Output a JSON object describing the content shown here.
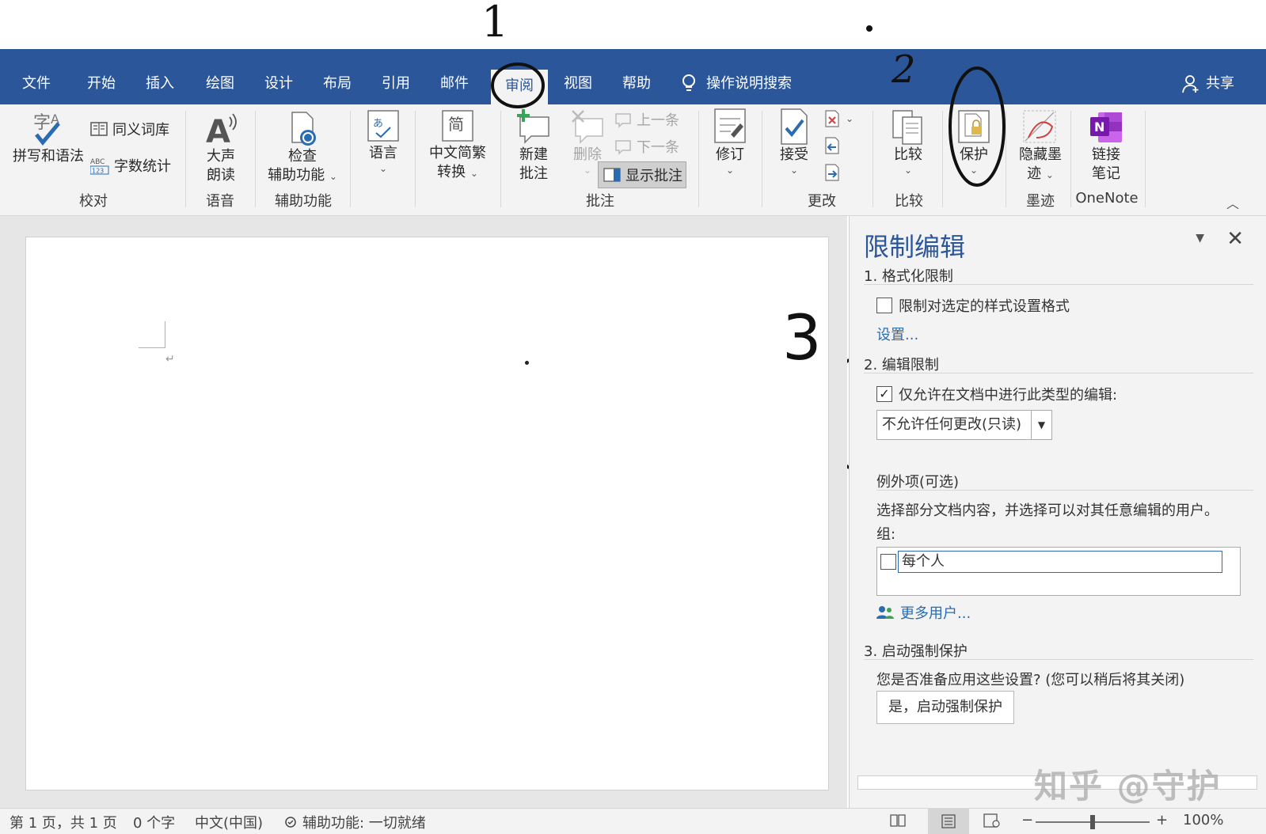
{
  "annotations": {
    "step1": "1",
    "step2": "2",
    "step3": "3"
  },
  "tabs": [
    "文件",
    "开始",
    "插入",
    "绘图",
    "设计",
    "布局",
    "引用",
    "邮件",
    "审阅",
    "视图",
    "帮助"
  ],
  "active_tab": "审阅",
  "tell_me": "操作说明搜索",
  "share_label": "共享",
  "ribbon": {
    "proofing": {
      "spelling": "拼写和语法",
      "thesaurus": "同义词库",
      "word_count": "字数统计",
      "group": "校对"
    },
    "speech": {
      "read_aloud_1": "大声",
      "read_aloud_2": "朗读",
      "group": "语音"
    },
    "accessibility": {
      "check_1": "检查",
      "check_2": "辅助功能",
      "group": "辅助功能"
    },
    "language": {
      "label": "语言"
    },
    "chinese_conv": {
      "label_1": "中文简繁",
      "label_2": "转换"
    },
    "comments": {
      "new_1": "新建",
      "new_2": "批注",
      "delete": "删除",
      "prev": "上一条",
      "next": "下一条",
      "show": "显示批注",
      "group": "批注"
    },
    "tracking": {
      "label": "修订"
    },
    "changes": {
      "accept": "接受",
      "group": "更改"
    },
    "compare": {
      "label": "比较",
      "group": "比较"
    },
    "protect": {
      "label": "保护"
    },
    "ink": {
      "hide_1": "隐藏墨",
      "hide_2": "迹",
      "group": "墨迹"
    },
    "onenote": {
      "link_1": "链接",
      "link_2": "笔记",
      "group": "OneNote"
    }
  },
  "pane": {
    "title": "限制编辑",
    "section1": "1. 格式化限制",
    "format_limit": "限制对选定的样式设置格式",
    "settings_link": "设置...",
    "section2": "2. 编辑限制",
    "edit_limit": "仅允许在文档中进行此类型的编辑:",
    "edit_limit_checked": true,
    "edit_type": "不允许任何更改(只读)",
    "exceptions_h": "例外项(可选)",
    "exceptions_desc": "选择部分文档内容，并选择可以对其任意编辑的用户。",
    "groups_label": "组:",
    "group_item": "每个人",
    "more_users": "更多用户...",
    "section3": "3. 启动强制保护",
    "enforce_desc": "您是否准备应用这些设置? (您可以稍后将其关闭)",
    "enforce_btn": "是，启动强制保护"
  },
  "status": {
    "page": "第 1 页，共 1 页",
    "words": "0 个字",
    "lang": "中文(中国)",
    "a11y": "辅助功能: 一切就绪",
    "zoom": "100%",
    "zoom_level_pct": 100
  },
  "watermark": "知乎 @守护",
  "colors": {
    "brand": "#2b579a",
    "ribbon_bg": "#f3f3f3",
    "link": "#2b6cb0"
  }
}
